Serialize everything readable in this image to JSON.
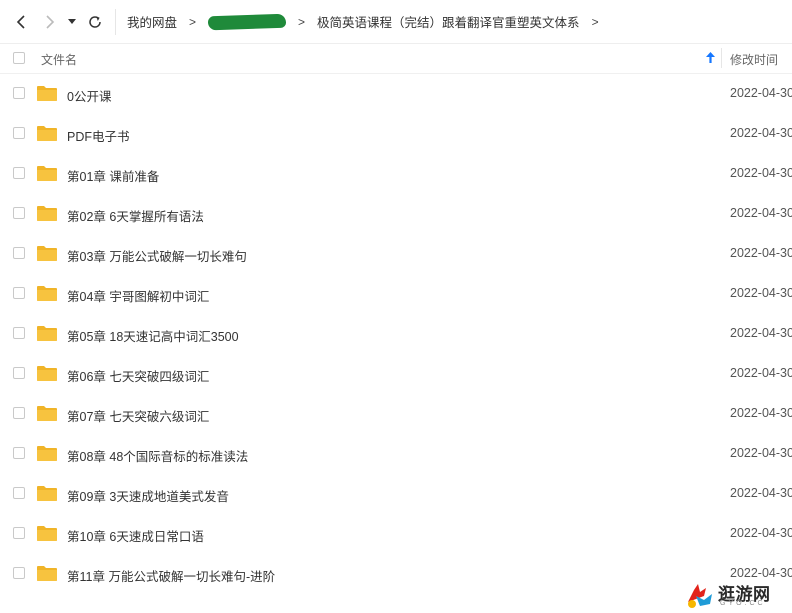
{
  "toolbar": {
    "breadcrumb": [
      {
        "label": "我的网盘",
        "redacted": false
      },
      {
        "label": "",
        "redacted": true
      },
      {
        "label": "极简英语课程（完结）跟着翻译官重塑英文体系",
        "redacted": false
      }
    ],
    "separator": ">"
  },
  "header": {
    "name_label": "文件名",
    "time_label": "修改时间",
    "sort_direction": "ascending"
  },
  "files": [
    {
      "name": "0公开课",
      "date": "2022-04-30"
    },
    {
      "name": "PDF电子书",
      "date": "2022-04-30"
    },
    {
      "name": "第01章 课前准备",
      "date": "2022-04-30"
    },
    {
      "name": "第02章 6天掌握所有语法",
      "date": "2022-04-30"
    },
    {
      "name": "第03章 万能公式破解一切长难句",
      "date": "2022-04-30"
    },
    {
      "name": "第04章 宇哥图解初中词汇",
      "date": "2022-04-30"
    },
    {
      "name": "第05章 18天速记高中词汇3500",
      "date": "2022-04-30"
    },
    {
      "name": "第06章  七天突破四级词汇",
      "date": "2022-04-30"
    },
    {
      "name": "第07章 七天突破六级词汇",
      "date": "2022-04-30"
    },
    {
      "name": "第08章 48个国际音标的标准读法",
      "date": "2022-04-30"
    },
    {
      "name": "第09章 3天速成地道美式发音",
      "date": "2022-04-30"
    },
    {
      "name": "第10章 6天速成日常口语",
      "date": "2022-04-30"
    },
    {
      "name": "第11章 万能公式破解一切长难句-进阶",
      "date": "2022-04-30"
    }
  ],
  "watermark": {
    "text": "逛游网",
    "sub": "GYO.CC"
  },
  "colors": {
    "folder": "#f7c33f",
    "folder_tab": "#f0b428",
    "accent": "#1677ff"
  },
  "icons": [
    "back-icon",
    "forward-icon",
    "dropdown-icon",
    "refresh-icon",
    "sort-up-icon",
    "folder-icon"
  ]
}
